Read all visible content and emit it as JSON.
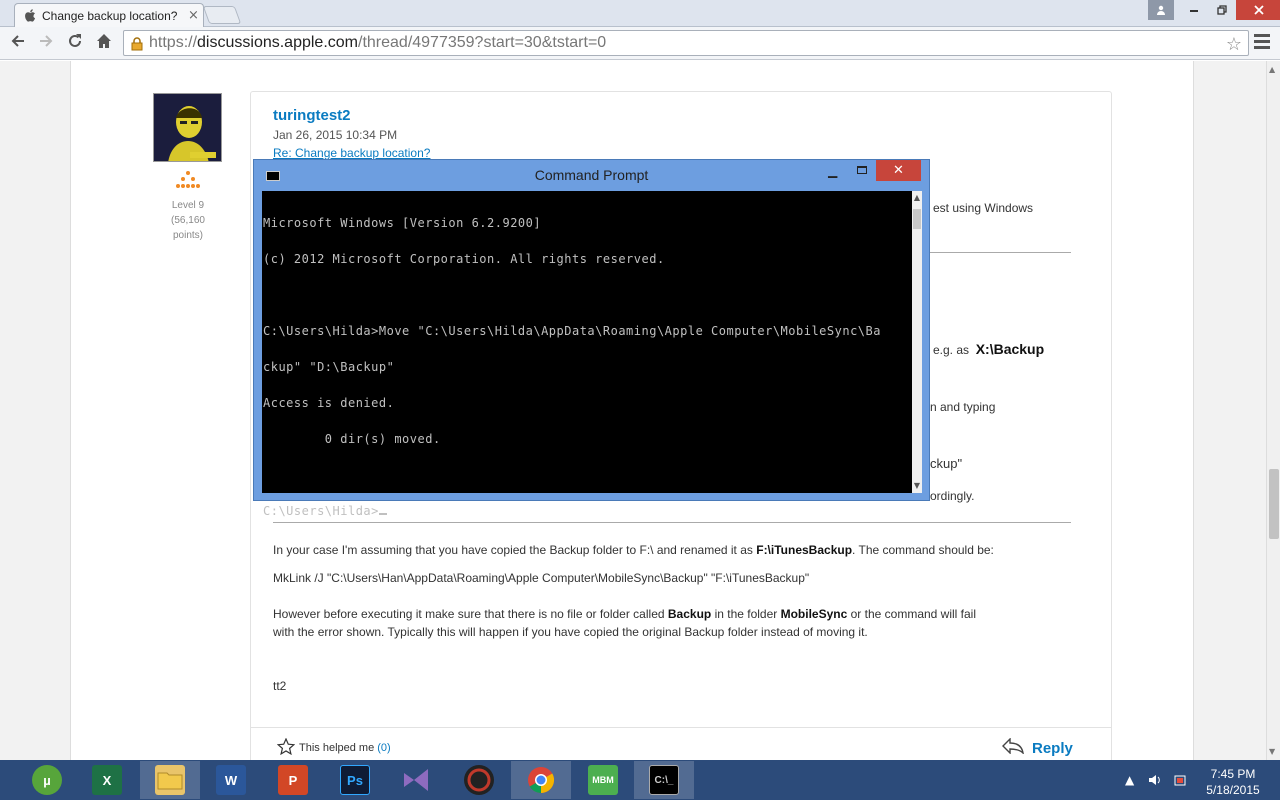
{
  "browser": {
    "tab_title": "Change backup location?",
    "tab_close": "×",
    "url_prefix": "https://",
    "url_host": "discussions.apple.com",
    "url_path": "/thread/4977359?start=30&tstart=0"
  },
  "post": {
    "author": "turingtest2",
    "date": "Jan 26, 2015 10:34 PM",
    "re_link": "Re: Change backup location?",
    "level": "Level 9",
    "points": "(56,160",
    "points2": "points)",
    "frag1": "est using Windows",
    "frag2_prefix": "e.g. as",
    "frag2_bold": "X:\\Backup",
    "frag3": "n and typing",
    "frag4": "ckup\"",
    "frag5": "ordingly.",
    "para1_pre": "In your case I'm assuming that you have copied the Backup folder to F:\\ and renamed it as ",
    "para1_bold": "F:\\iTunesBackup",
    "para1_post": ". The command should be:",
    "mklink": "MkLink /J \"C:\\Users\\Han\\AppData\\Roaming\\Apple Computer\\MobileSync\\Backup\" \"F:\\iTunesBackup\"",
    "para2_a": "However before executing it make sure that there is no file or folder called ",
    "para2_bold1": "Backup",
    "para2_b": " in the folder ",
    "para2_bold2": "MobileSync",
    "para2_c": " or the command will fail",
    "para2_line2": "with the error shown. Typically this will happen if you have copied the original Backup folder instead of moving it.",
    "signature": "tt2",
    "helped_label": "This helped me",
    "helped_count": "(0)",
    "reply_label": "Reply"
  },
  "cmd": {
    "title": "Command Prompt",
    "close": "✕",
    "lines": [
      "Microsoft Windows [Version 6.2.9200]",
      "(c) 2012 Microsoft Corporation. All rights reserved.",
      "",
      "C:\\Users\\Hilda>Move \"C:\\Users\\Hilda\\AppData\\Roaming\\Apple Computer\\MobileSync\\Ba",
      "ckup\" \"D:\\Backup\"",
      "Access is denied.",
      "        0 dir(s) moved.",
      "",
      "C:\\Users\\Hilda>"
    ]
  },
  "taskbar": {
    "time": "7:45 PM",
    "date": "5/18/2015",
    "apps": [
      "utorrent",
      "excel",
      "explorer",
      "word",
      "powerpoint",
      "photoshop",
      "visual-studio",
      "media-app",
      "chrome",
      "mbm-app",
      "command-prompt"
    ]
  },
  "colors": {
    "link": "#0a7bc1",
    "taskbar": "#2c4b7a",
    "window_frame": "#6d9ee0",
    "close_red": "#c7453b"
  }
}
